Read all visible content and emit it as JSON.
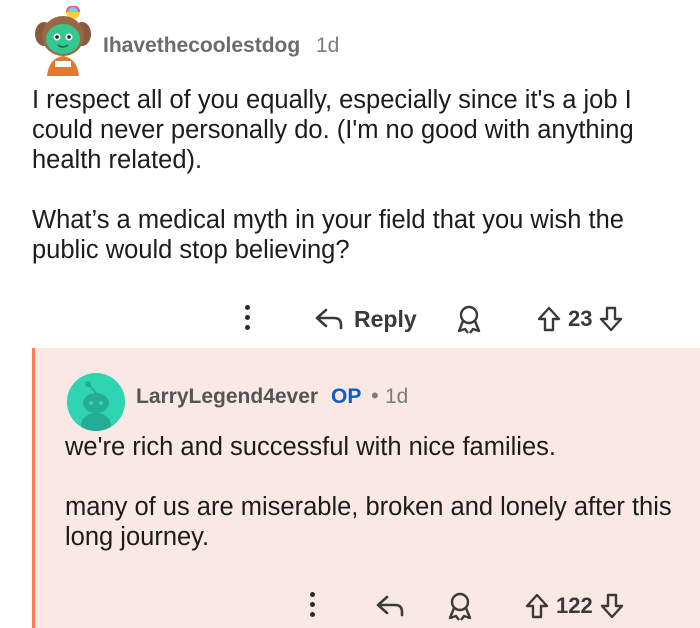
{
  "comment1": {
    "username": "Ihavethecoolestdog",
    "time": "1d",
    "paragraphs": [
      "I respect all of you equally, especially since it's a job I could never personally do. (I'm no good with anything health related).",
      "What’s a medical myth in your field that you wish the public would stop believing?"
    ],
    "reply_label": "Reply",
    "vote_count": "23",
    "icons": [
      "more-options-icon",
      "reply-arrow-icon",
      "award-icon",
      "upvote-icon",
      "downvote-icon"
    ]
  },
  "comment2": {
    "username": "LarryLegend4ever",
    "op_badge": "OP",
    "separator": "•",
    "time": "1d",
    "paragraphs": [
      "we're rich and successful with nice families.",
      "many of us are miserable, broken and lonely after this long journey."
    ],
    "vote_count": "122",
    "colors": {
      "background": "#fae8e4",
      "thread_line": "#ff7c59",
      "op_badge": "#0a5dc2",
      "avatar": "#2fd5b3"
    }
  }
}
